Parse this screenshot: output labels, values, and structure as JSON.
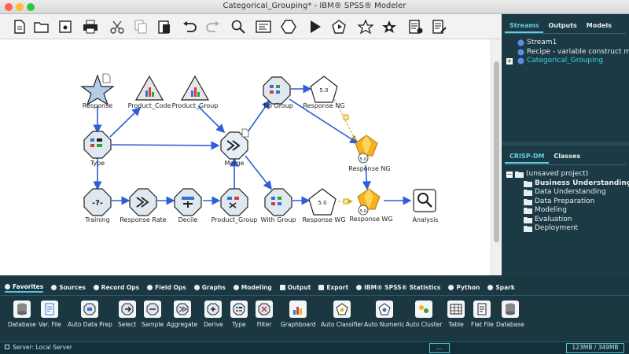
{
  "window": {
    "title": "Categorical_Grouping* - IBM® SPSS® Modeler",
    "traffic_colors": [
      "#fe5f57",
      "#febc2e",
      "#28c840"
    ]
  },
  "toolbar": {
    "icons": [
      "new-stream-icon",
      "open-stream-icon",
      "save-stream-icon",
      "print-icon",
      "cut-icon",
      "copy-icon",
      "paste-icon",
      "undo-icon",
      "redo-icon",
      "search-icon",
      "stream-properties-icon",
      "supernode-icon",
      "run-icon",
      "run-selection-icon",
      "favorite-icon",
      "favorite-settings-icon",
      "output-icon",
      "annotation-icon"
    ]
  },
  "canvas": {
    "nodes": [
      {
        "id": "response",
        "label": "Response"
      },
      {
        "id": "product_code",
        "label": "Product_Code"
      },
      {
        "id": "product_group_graph",
        "label": "Product_Group"
      },
      {
        "id": "no_group",
        "label": "No Group"
      },
      {
        "id": "response_ng_model",
        "label": "Response NG"
      },
      {
        "id": "type",
        "label": "Type"
      },
      {
        "id": "merge",
        "label": "Merge"
      },
      {
        "id": "response_ng_nugget",
        "label": "Response NG",
        "badge": "5.0"
      },
      {
        "id": "training",
        "label": "Training"
      },
      {
        "id": "response_rate",
        "label": "Response Rate"
      },
      {
        "id": "decile",
        "label": "Decile"
      },
      {
        "id": "product_group_derive",
        "label": "Product_Group"
      },
      {
        "id": "with_group",
        "label": "With Group"
      },
      {
        "id": "response_wg_model",
        "label": "Response WG"
      },
      {
        "id": "response_wg_nugget",
        "label": "Response WG",
        "badge": "5.0"
      },
      {
        "id": "analysis",
        "label": "Analysis"
      }
    ]
  },
  "right_panel": {
    "tabs": [
      "Streams",
      "Outputs",
      "Models"
    ],
    "streams": [
      "Stream1",
      "Recipe - variable construct mu",
      "Categorical_Grouping"
    ],
    "crisp_tabs": [
      "CRISP-DM",
      "Classes"
    ],
    "project_root": "(unsaved project)",
    "project_folders": [
      "Business Understanding",
      "Data Understanding",
      "Data Preparation",
      "Modeling",
      "Evaluation",
      "Deployment"
    ]
  },
  "palette": {
    "tabs": [
      "Favorites",
      "Sources",
      "Record Ops",
      "Field Ops",
      "Graphs",
      "Modeling",
      "Output",
      "Export",
      "IBM® SPSS® Statistics",
      "Python",
      "Spark"
    ],
    "items": [
      "Database",
      "Var. File",
      "Auto Data Prep",
      "Select",
      "Sample",
      "Aggregate",
      "Derive",
      "Type",
      "Filter",
      "Graphboard",
      "Auto Classifier",
      "Auto Numeric",
      "Auto Cluster",
      "Table",
      "Flat File",
      "Database"
    ]
  },
  "status": {
    "server": "Server: Local Server",
    "ellipsis": "...",
    "memory": "123MB / 349MB"
  },
  "colors": {
    "arrow": "#2f5fd6",
    "panel_bg": "#1c3a45",
    "accent": "#5fd0e0",
    "nugget": "#f5b020",
    "link_active": "#3cd3e6"
  }
}
